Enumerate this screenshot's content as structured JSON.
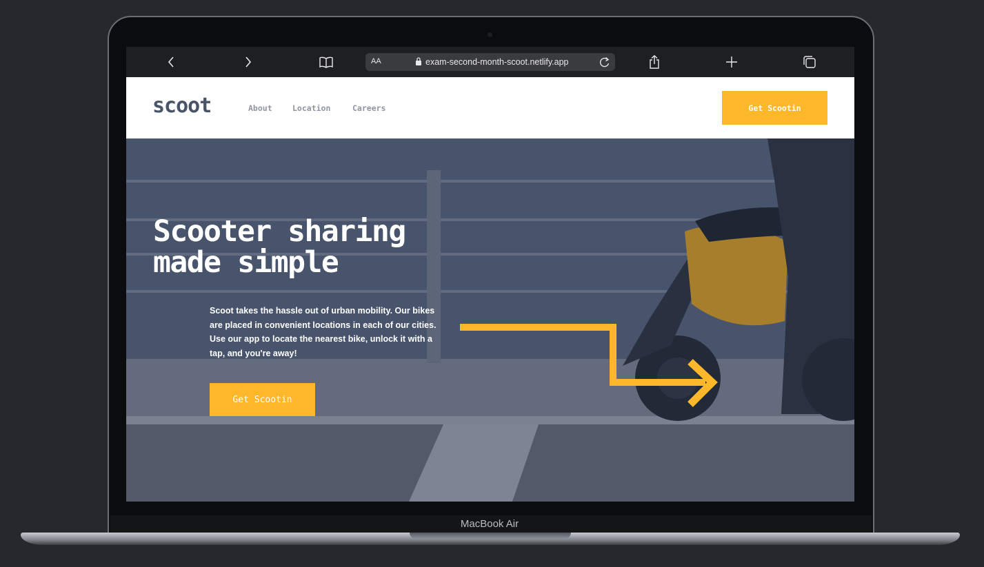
{
  "device": {
    "label": "MacBook Air"
  },
  "browser": {
    "text_size_label": "AA",
    "url": "exam-second-month-scoot.netlify.app",
    "icons": [
      "chevron-left-icon",
      "chevron-right-icon",
      "book-icon",
      "lock-icon",
      "reload-icon",
      "share-icon",
      "plus-icon",
      "tabs-icon"
    ]
  },
  "site": {
    "logo": "scoot",
    "nav": [
      {
        "label": "About"
      },
      {
        "label": "Location"
      },
      {
        "label": "Careers"
      }
    ],
    "nav_cta": "Get Scootin",
    "hero": {
      "title": "Scooter sharing made simple",
      "body": "Scoot takes the hassle out of urban mobility. Our bikes are placed in convenient locations in each of our cities. Use our app to locate the nearest bike, unlock it with a tap, and you're away!",
      "cta": "Get Scootin"
    },
    "colors": {
      "accent": "#fcb72b",
      "logo": "#495567",
      "nav_link": "#8f96a3",
      "hero_overlay": "#4a5670"
    }
  }
}
